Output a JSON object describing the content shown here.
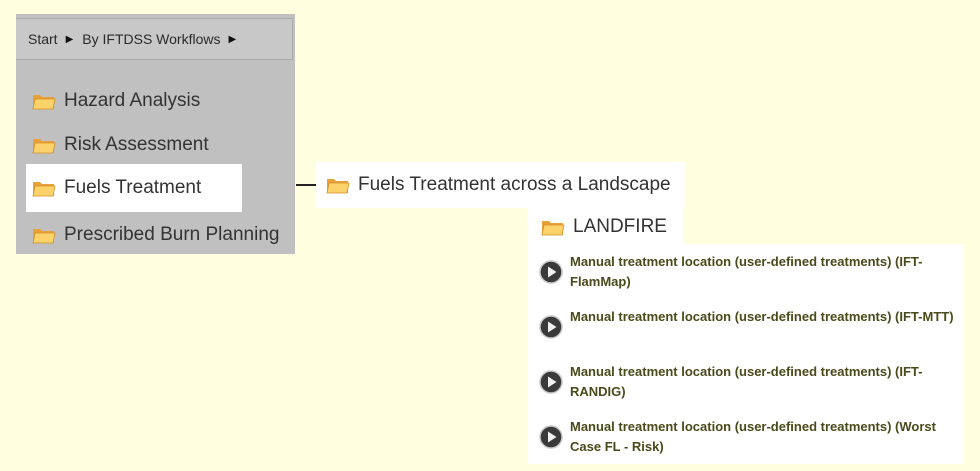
{
  "breadcrumb": {
    "items": [
      {
        "label": "Start"
      },
      {
        "label": "By IFTDSS Workflows"
      }
    ]
  },
  "menu": {
    "items": [
      {
        "label": "Hazard Analysis",
        "icon": "folder-icon"
      },
      {
        "label": "Risk Assessment",
        "icon": "folder-icon"
      },
      {
        "label": "Fuels Treatment",
        "icon": "folder-icon",
        "selected": true
      },
      {
        "label": "Prescribed Burn Planning",
        "icon": "folder-icon"
      }
    ]
  },
  "submenu": {
    "level1": {
      "label": "Fuels Treatment across a Landscape",
      "icon": "folder-icon"
    },
    "level2": {
      "label": "LANDFIRE",
      "icon": "folder-icon"
    }
  },
  "workflows": [
    {
      "label": "Manual treatment location (user-defined treatments) (IFT-FlamMap)",
      "icon": "play-icon"
    },
    {
      "label": "Manual treatment location (user-defined treatments) (IFT-MTT)",
      "icon": "play-icon"
    },
    {
      "label": "Manual treatment location (user-defined treatments) (IFT-RANDIG)",
      "icon": "play-icon"
    },
    {
      "label": "Manual treatment location (user-defined treatments) (Worst Case FL - Risk)",
      "icon": "play-icon"
    }
  ],
  "colors": {
    "background": "#ffffe0",
    "panel": "#c0c0c0",
    "folder": "#f5b942",
    "play": "#444444"
  }
}
